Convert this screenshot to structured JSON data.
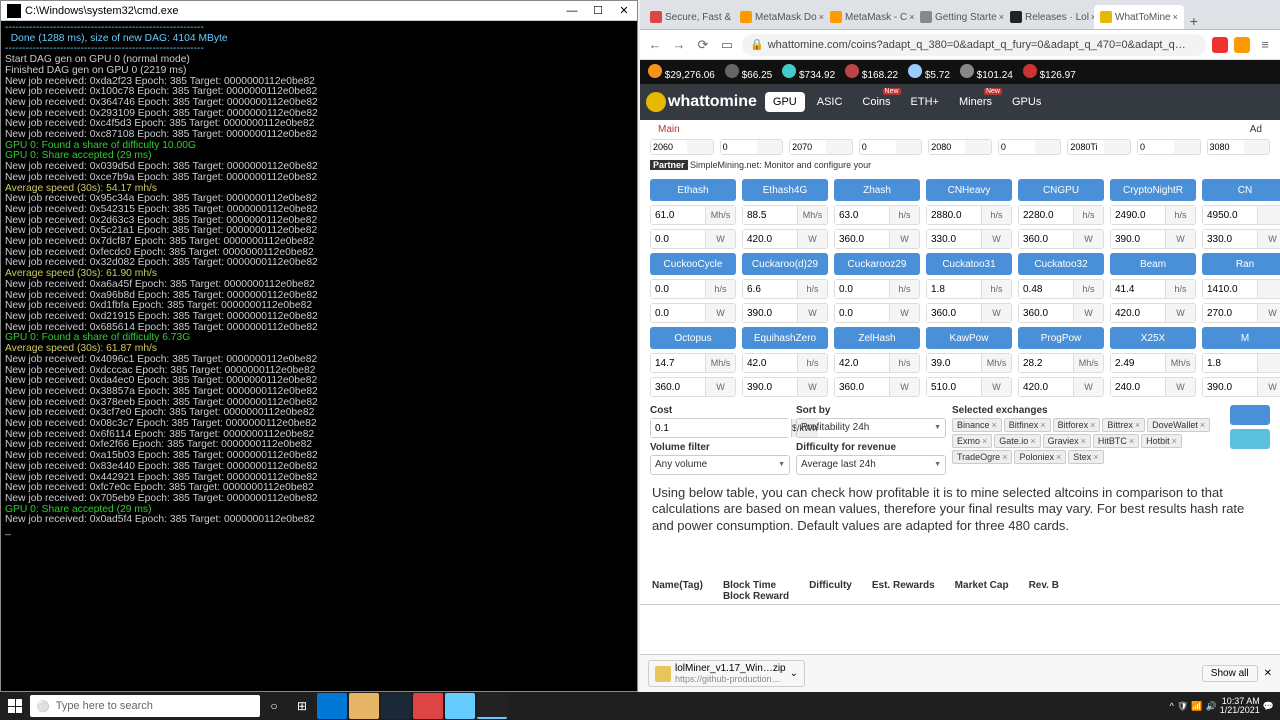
{
  "terminal": {
    "title": "C:\\Windows\\system32\\cmd.exe",
    "lines": [
      {
        "t": "----------------------------------------------------------",
        "c": "cyan"
      },
      {
        "t": "  Done (1288 ms), size of new DAG: 4104 MByte",
        "c": "cyan"
      },
      {
        "t": "----------------------------------------------------------",
        "c": "cyan"
      },
      {
        "t": "Start DAG gen on GPU 0 (normal mode)",
        "c": ""
      },
      {
        "t": "Finished DAG gen on GPU 0 (2219 ms)",
        "c": ""
      },
      {
        "t": "New job received: 0xda2f23 Epoch: 385 Target: 0000000112e0be82",
        "c": ""
      },
      {
        "t": "New job received: 0x100c78 Epoch: 385 Target: 0000000112e0be82",
        "c": ""
      },
      {
        "t": "New job received: 0x364746 Epoch: 385 Target: 0000000112e0be82",
        "c": ""
      },
      {
        "t": "New job received: 0x293109 Epoch: 385 Target: 0000000112e0be82",
        "c": ""
      },
      {
        "t": "New job received: 0xc4f5d3 Epoch: 385 Target: 0000000112e0be82",
        "c": ""
      },
      {
        "t": "New job received: 0xc87108 Epoch: 385 Target: 0000000112e0be82",
        "c": ""
      },
      {
        "t": "GPU 0: Found a share of difficulty 10.00G",
        "c": "green"
      },
      {
        "t": "GPU 0: Share accepted (29 ms)",
        "c": "green"
      },
      {
        "t": "New job received: 0x039d5d Epoch: 385 Target: 0000000112e0be82",
        "c": ""
      },
      {
        "t": "New job received: 0xce7b9a Epoch: 385 Target: 0000000112e0be82",
        "c": ""
      },
      {
        "t": "Average speed (30s): 54.17 mh/s",
        "c": "yellow"
      },
      {
        "t": "New job received: 0x95c34a Epoch: 385 Target: 0000000112e0be82",
        "c": ""
      },
      {
        "t": "New job received: 0x542315 Epoch: 385 Target: 0000000112e0be82",
        "c": ""
      },
      {
        "t": "New job received: 0x2d63c3 Epoch: 385 Target: 0000000112e0be82",
        "c": ""
      },
      {
        "t": "New job received: 0x5c21a1 Epoch: 385 Target: 0000000112e0be82",
        "c": ""
      },
      {
        "t": "New job received: 0x7dcf87 Epoch: 385 Target: 0000000112e0be82",
        "c": ""
      },
      {
        "t": "New job received: 0xfecdc0 Epoch: 385 Target: 0000000112e0be82",
        "c": ""
      },
      {
        "t": "New job received: 0x32d082 Epoch: 385 Target: 0000000112e0be82",
        "c": ""
      },
      {
        "t": "Average speed (30s): 61.90 mh/s",
        "c": "yellow"
      },
      {
        "t": "New job received: 0xa6a45f Epoch: 385 Target: 0000000112e0be82",
        "c": ""
      },
      {
        "t": "New job received: 0xa96b8d Epoch: 385 Target: 0000000112e0be82",
        "c": ""
      },
      {
        "t": "New job received: 0xd1fbfa Epoch: 385 Target: 0000000112e0be82",
        "c": ""
      },
      {
        "t": "New job received: 0xd21915 Epoch: 385 Target: 0000000112e0be82",
        "c": ""
      },
      {
        "t": "New job received: 0x685614 Epoch: 385 Target: 0000000112e0be82",
        "c": ""
      },
      {
        "t": "GPU 0: Found a share of difficulty 6.73G",
        "c": "green"
      },
      {
        "t": "Average speed (30s): 61.87 mh/s",
        "c": "yellow"
      },
      {
        "t": "New job received: 0x4096c1 Epoch: 385 Target: 0000000112e0be82",
        "c": ""
      },
      {
        "t": "New job received: 0xdcccac Epoch: 385 Target: 0000000112e0be82",
        "c": ""
      },
      {
        "t": "New job received: 0xda4ec0 Epoch: 385 Target: 0000000112e0be82",
        "c": ""
      },
      {
        "t": "New job received: 0x38857a Epoch: 385 Target: 0000000112e0be82",
        "c": ""
      },
      {
        "t": "New job received: 0x378eeb Epoch: 385 Target: 0000000112e0be82",
        "c": ""
      },
      {
        "t": "New job received: 0x3cf7e0 Epoch: 385 Target: 0000000112e0be82",
        "c": ""
      },
      {
        "t": "New job received: 0x08c3c7 Epoch: 385 Target: 0000000112e0be82",
        "c": ""
      },
      {
        "t": "New job received: 0x6f6114 Epoch: 385 Target: 0000000112e0be82",
        "c": ""
      },
      {
        "t": "New job received: 0xfe2f66 Epoch: 385 Target: 0000000112e0be82",
        "c": ""
      },
      {
        "t": "New job received: 0xa15b03 Epoch: 385 Target: 0000000112e0be82",
        "c": ""
      },
      {
        "t": "New job received: 0x83e440 Epoch: 385 Target: 0000000112e0be82",
        "c": ""
      },
      {
        "t": "New job received: 0x442921 Epoch: 385 Target: 0000000112e0be82",
        "c": ""
      },
      {
        "t": "New job received: 0xfc7e0c Epoch: 385 Target: 0000000112e0be82",
        "c": ""
      },
      {
        "t": "New job received: 0x705eb9 Epoch: 385 Target: 0000000112e0be82",
        "c": ""
      },
      {
        "t": "GPU 0: Share accepted (29 ms)",
        "c": "green"
      },
      {
        "t": "New job received: 0x0ad5f4 Epoch: 385 Target: 0000000112e0be82",
        "c": ""
      },
      {
        "t": "_",
        "c": ""
      }
    ]
  },
  "browser": {
    "tabs": [
      {
        "label": "Secure, Fast &",
        "favicon": "#d44"
      },
      {
        "label": "MetaMask Do",
        "favicon": "#f90"
      },
      {
        "label": "MetaMask - C",
        "favicon": "#f90"
      },
      {
        "label": "Getting Starte",
        "favicon": "#888"
      },
      {
        "label": "Releases · Lol",
        "favicon": "#222"
      },
      {
        "label": "WhatToMine",
        "favicon": "#e6b800",
        "active": true
      }
    ],
    "url": "whattomine.com/coins?adapt_q_380=0&adapt_q_fury=0&adapt_q_470=0&adapt_q…"
  },
  "ticker": [
    {
      "color": "#f7931a",
      "val": "$29,276.06"
    },
    {
      "color": "#666",
      "val": "$66.25"
    },
    {
      "color": "#4cc",
      "val": "$734.92"
    },
    {
      "color": "#b44",
      "val": "$168.22"
    },
    {
      "color": "#9cf",
      "val": "$5.72"
    },
    {
      "color": "#888",
      "val": "$101.24"
    },
    {
      "color": "#c33",
      "val": "$126.97"
    }
  ],
  "nav": [
    "GPU",
    "ASIC",
    "Coins",
    "ETH+",
    "Miners",
    "GPUs"
  ],
  "subnav": {
    "main": "Main"
  },
  "gpurow": [
    "2060",
    "0",
    "2070",
    "0",
    "2080",
    "0",
    "2080Ti",
    "0",
    "3080"
  ],
  "partner": "SimpleMining.net: Monitor and configure your",
  "algos": [
    {
      "name": "Ethash",
      "hr": "61.0",
      "hu": "Mh/s",
      "w": "0.0"
    },
    {
      "name": "Ethash4G",
      "hr": "88.5",
      "hu": "Mh/s",
      "w": "420.0"
    },
    {
      "name": "Zhash",
      "hr": "63.0",
      "hu": "h/s",
      "w": "360.0"
    },
    {
      "name": "CNHeavy",
      "hr": "2880.0",
      "hu": "h/s",
      "w": "330.0"
    },
    {
      "name": "CNGPU",
      "hr": "2280.0",
      "hu": "h/s",
      "w": "360.0"
    },
    {
      "name": "CryptoNightR",
      "hr": "2490.0",
      "hu": "h/s",
      "w": "390.0"
    },
    {
      "name": "CN",
      "hr": "4950.0",
      "hu": "",
      "w": "330.0"
    },
    {
      "name": "CuckooCycle",
      "hr": "0.0",
      "hu": "h/s",
      "w": "0.0"
    },
    {
      "name": "Cuckaroo(d)29",
      "hr": "6.6",
      "hu": "h/s",
      "w": "390.0"
    },
    {
      "name": "Cuckarooz29",
      "hr": "0.0",
      "hu": "h/s",
      "w": "0.0"
    },
    {
      "name": "Cuckatoo31",
      "hr": "1.8",
      "hu": "h/s",
      "w": "360.0"
    },
    {
      "name": "Cuckatoo32",
      "hr": "0.48",
      "hu": "h/s",
      "w": "360.0"
    },
    {
      "name": "Beam",
      "hr": "41.4",
      "hu": "h/s",
      "w": "420.0"
    },
    {
      "name": "Ran",
      "hr": "1410.0",
      "hu": "",
      "w": "270.0"
    },
    {
      "name": "Octopus",
      "hr": "14.7",
      "hu": "Mh/s",
      "w": "360.0"
    },
    {
      "name": "EquihashZero",
      "hr": "42.0",
      "hu": "h/s",
      "w": "390.0"
    },
    {
      "name": "ZelHash",
      "hr": "42.0",
      "hu": "h/s",
      "w": "360.0"
    },
    {
      "name": "KawPow",
      "hr": "39.0",
      "hu": "Mh/s",
      "w": "510.0"
    },
    {
      "name": "ProgPow",
      "hr": "28.2",
      "hu": "Mh/s",
      "w": "420.0"
    },
    {
      "name": "X25X",
      "hr": "2.49",
      "hu": "Mh/s",
      "w": "240.0"
    },
    {
      "name": "M",
      "hr": "1.8",
      "hu": "",
      "w": "390.0"
    }
  ],
  "controls": {
    "cost_label": "Cost",
    "cost": "0.1",
    "cost_unit": "$/kWh",
    "sort_label": "Sort by",
    "sort": "Profitability 24h",
    "vol_label": "Volume filter",
    "vol": "Any volume",
    "diff_label": "Difficulty for revenue",
    "diff": "Average last 24h",
    "exch_label": "Selected exchanges",
    "exchanges": [
      "Binance",
      "Bitfinex",
      "Bitforex",
      "Bittrex",
      "DoveWallet",
      "Exmo",
      "Gate.io",
      "Graviex",
      "HitBTC",
      "Hotbit",
      "TradeOgre",
      "Poloniex",
      "Stex"
    ]
  },
  "paragraph": "Using below table, you can check how profitable it is to mine selected altcoins in comparison to that calculations are based on mean values, therefore your final results may vary. For best results hash rate and power consumption. Default values are adapted for three 480 cards.",
  "table_head": [
    "Name(Tag)",
    "Block Time\nBlock Reward",
    "Difficulty",
    "Est. Rewards",
    "Market Cap",
    "Rev. B"
  ],
  "download": {
    "name": "lolMiner_v1.17_Win…zip",
    "sub": "https://github-production…",
    "showall": "Show all"
  },
  "taskbar": {
    "search": "Type here to search",
    "time": "10:37 AM",
    "date": "1/21/2021"
  }
}
